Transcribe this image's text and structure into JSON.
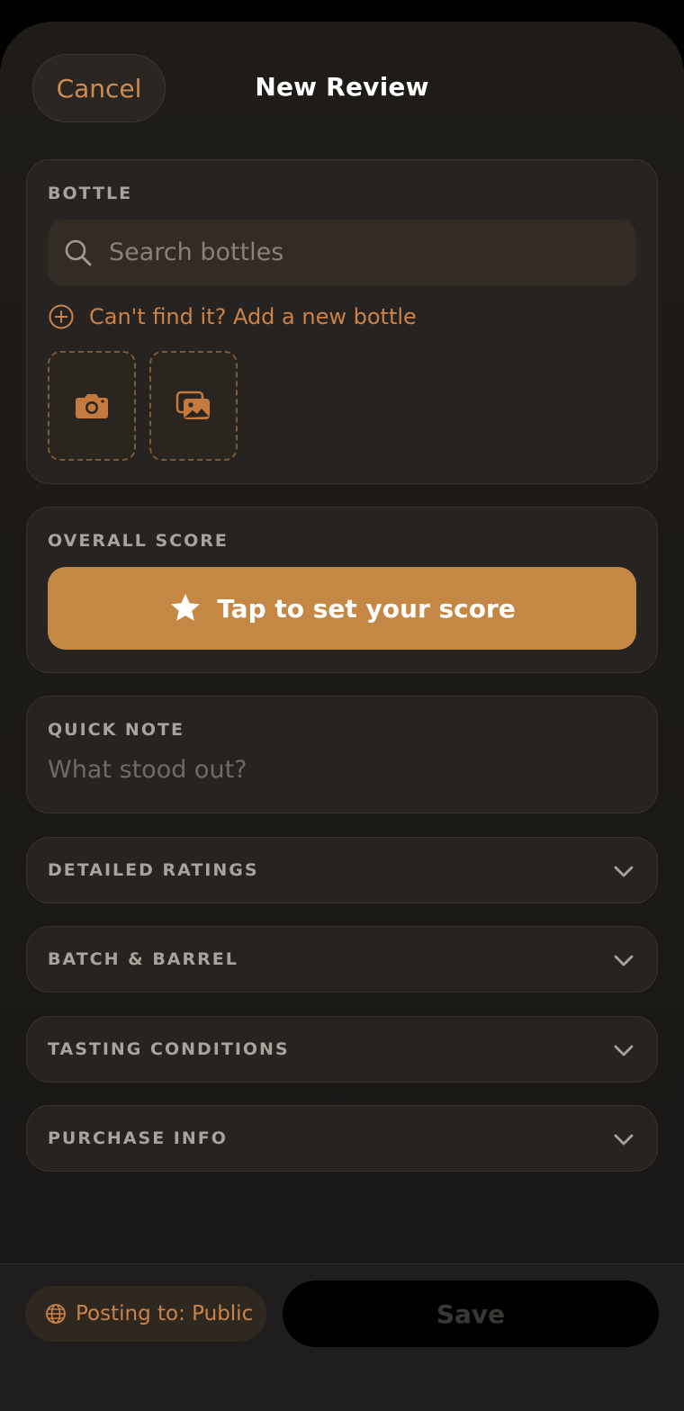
{
  "header": {
    "cancel_label": "Cancel",
    "title": "New Review"
  },
  "bottle": {
    "section_label": "BOTTLE",
    "search_placeholder": "Search bottles",
    "add_new_label": "Can't find it? Add a new bottle"
  },
  "score": {
    "section_label": "OVERALL SCORE",
    "button_label": "Tap to set your score"
  },
  "note": {
    "section_label": "QUICK NOTE",
    "placeholder": "What stood out?"
  },
  "sections": {
    "detailed": "DETAILED RATINGS",
    "batch": "BATCH & BARREL",
    "tasting": "TASTING CONDITIONS",
    "purchase": "PURCHASE INFO"
  },
  "footer": {
    "visibility_label": "Posting to: Public",
    "save_label": "Save"
  },
  "colors": {
    "accent": "#c58744",
    "accent_text": "#cc8349",
    "background": "#1f1c18"
  }
}
